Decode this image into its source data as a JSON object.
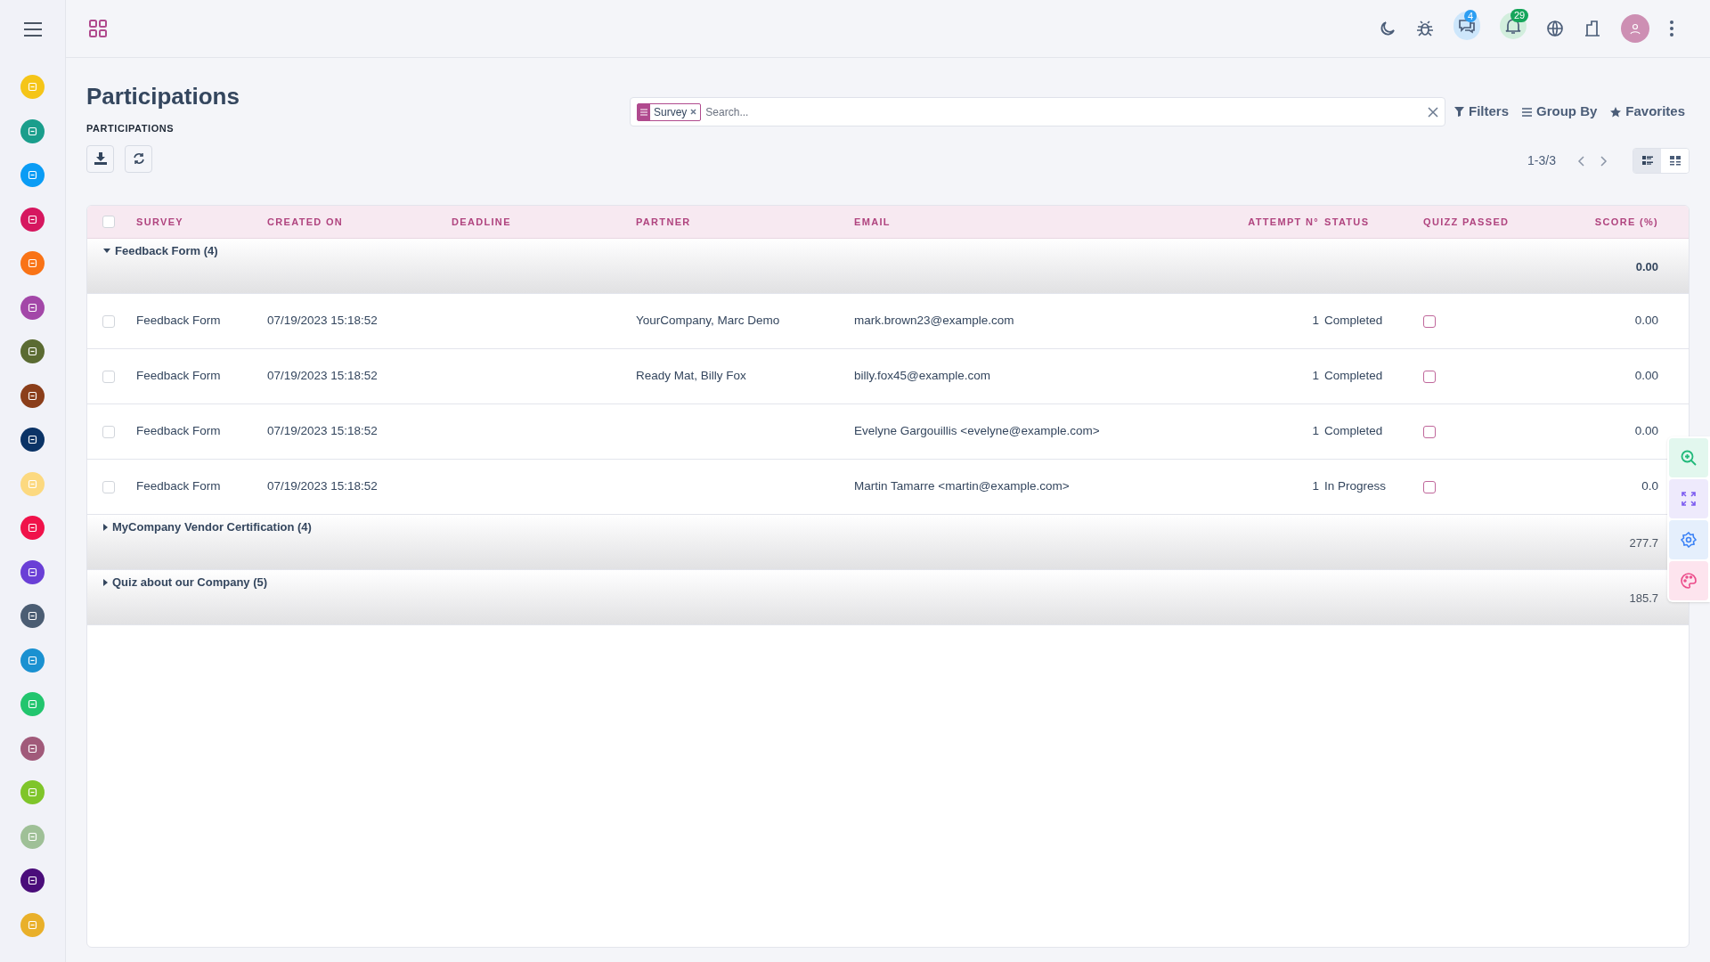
{
  "topbar": {
    "chat_badge": "4",
    "notification_badge": "29"
  },
  "sidebar": {
    "items": [
      {
        "color": "#f5c518"
      },
      {
        "color": "#1a9e8c"
      },
      {
        "color": "#0a9cf5"
      },
      {
        "color": "#d6175f"
      },
      {
        "color": "#f97316"
      },
      {
        "color": "#a347a8"
      },
      {
        "color": "#5b6b32"
      },
      {
        "color": "#8b3e1a"
      },
      {
        "color": "#0b3366"
      },
      {
        "color": "#fcd980"
      },
      {
        "color": "#f0124a"
      },
      {
        "color": "#6a3fd6"
      },
      {
        "color": "#4b5d73"
      },
      {
        "color": "#1a91d1"
      },
      {
        "color": "#22c56e"
      },
      {
        "color": "#a15a7a"
      },
      {
        "color": "#7fc52a"
      },
      {
        "color": "#9fc097"
      },
      {
        "color": "#4a0d7a"
      },
      {
        "color": "#e9b02a"
      }
    ]
  },
  "page": {
    "title": "Participations",
    "subtitle": "PARTICIPATIONS"
  },
  "search": {
    "facets": [
      {
        "label": "Survey"
      }
    ],
    "placeholder": "Search...",
    "buttons": [
      {
        "label": "Filters",
        "kind": "filter"
      },
      {
        "label": "Group By",
        "kind": "group"
      },
      {
        "label": "Favorites",
        "kind": "star"
      }
    ]
  },
  "pager": {
    "text": "1-3/3"
  },
  "views": [
    {
      "kind": "list",
      "selected": true
    },
    {
      "kind": "kanban",
      "selected": false
    }
  ],
  "table": {
    "select_all": false,
    "columns": [
      "SURVEY",
      "CREATED ON",
      "DEADLINE",
      "PARTNER",
      "EMAIL",
      "ATTEMPT N°",
      "STATUS",
      "QUIZZ PASSED",
      "SCORE (%)"
    ],
    "groups": [
      {
        "label": "Feedback Form (4)",
        "expanded": true,
        "total": "0.00",
        "rows": [
          {
            "survey": "Feedback Form",
            "created_on": "07/19/2023 15:18:52",
            "partner": "YourCompany, Marc Demo",
            "email": "mark.brown23@example.com",
            "attempt": "1",
            "status": "Completed",
            "quizz_passed": false,
            "score": "0.00",
            "selected": false
          },
          {
            "survey": "Feedback Form",
            "created_on": "07/19/2023 15:18:52",
            "partner": "Ready Mat, Billy Fox",
            "email": "billy.fox45@example.com",
            "attempt": "1",
            "status": "Completed",
            "quizz_passed": false,
            "score": "0.00",
            "selected": false
          },
          {
            "survey": "Feedback Form",
            "created_on": "07/19/2023 15:18:52",
            "email": "Evelyne Gargouillis <evelyne@example.com>",
            "attempt": "1",
            "status": "Completed",
            "quizz_passed": false,
            "score": "0.00",
            "selected": false
          },
          {
            "survey": "Feedback Form",
            "created_on": "07/19/2023 15:18:52",
            "email": "Martin Tamarre <martin@example.com>",
            "attempt": "1",
            "status": "In Progress",
            "quizz_passed": false,
            "score": "0.0",
            "selected": false
          }
        ]
      },
      {
        "label": "MyCompany Vendor Certification (4)",
        "expanded": false,
        "total": "277.7"
      },
      {
        "label": "Quiz about our Company (5)",
        "expanded": false,
        "total": "185.7"
      }
    ]
  }
}
